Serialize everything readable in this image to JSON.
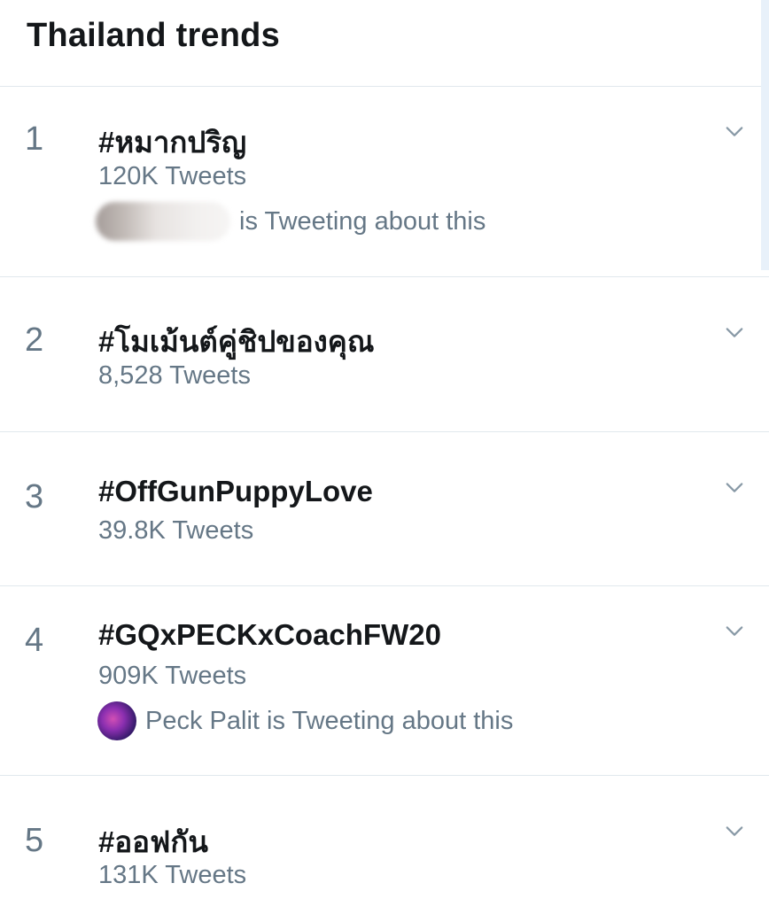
{
  "header": {
    "title": "Thailand trends"
  },
  "trends": [
    {
      "rank": "1",
      "name": "#หมากปริญ",
      "count": "120K Tweets",
      "context": "is Tweeting about this"
    },
    {
      "rank": "2",
      "name": "#โมเม้นต์คู่ชิปของคุณ",
      "count": "8,528 Tweets"
    },
    {
      "rank": "3",
      "name": "#OffGunPuppyLove",
      "count": "39.8K Tweets"
    },
    {
      "rank": "4",
      "name": "#GQxPECKxCoachFW20",
      "count": "909K Tweets",
      "context": "Peck Palit is Tweeting about this"
    },
    {
      "rank": "5",
      "name": "#ออฟกัน",
      "count": "131K Tweets"
    }
  ],
  "colors": {
    "primary_text": "#14171a",
    "secondary_text": "#657786",
    "divider": "#e1e8ed",
    "chevron": "#8899a6"
  },
  "icons": {
    "more": "chevron-down-icon"
  }
}
